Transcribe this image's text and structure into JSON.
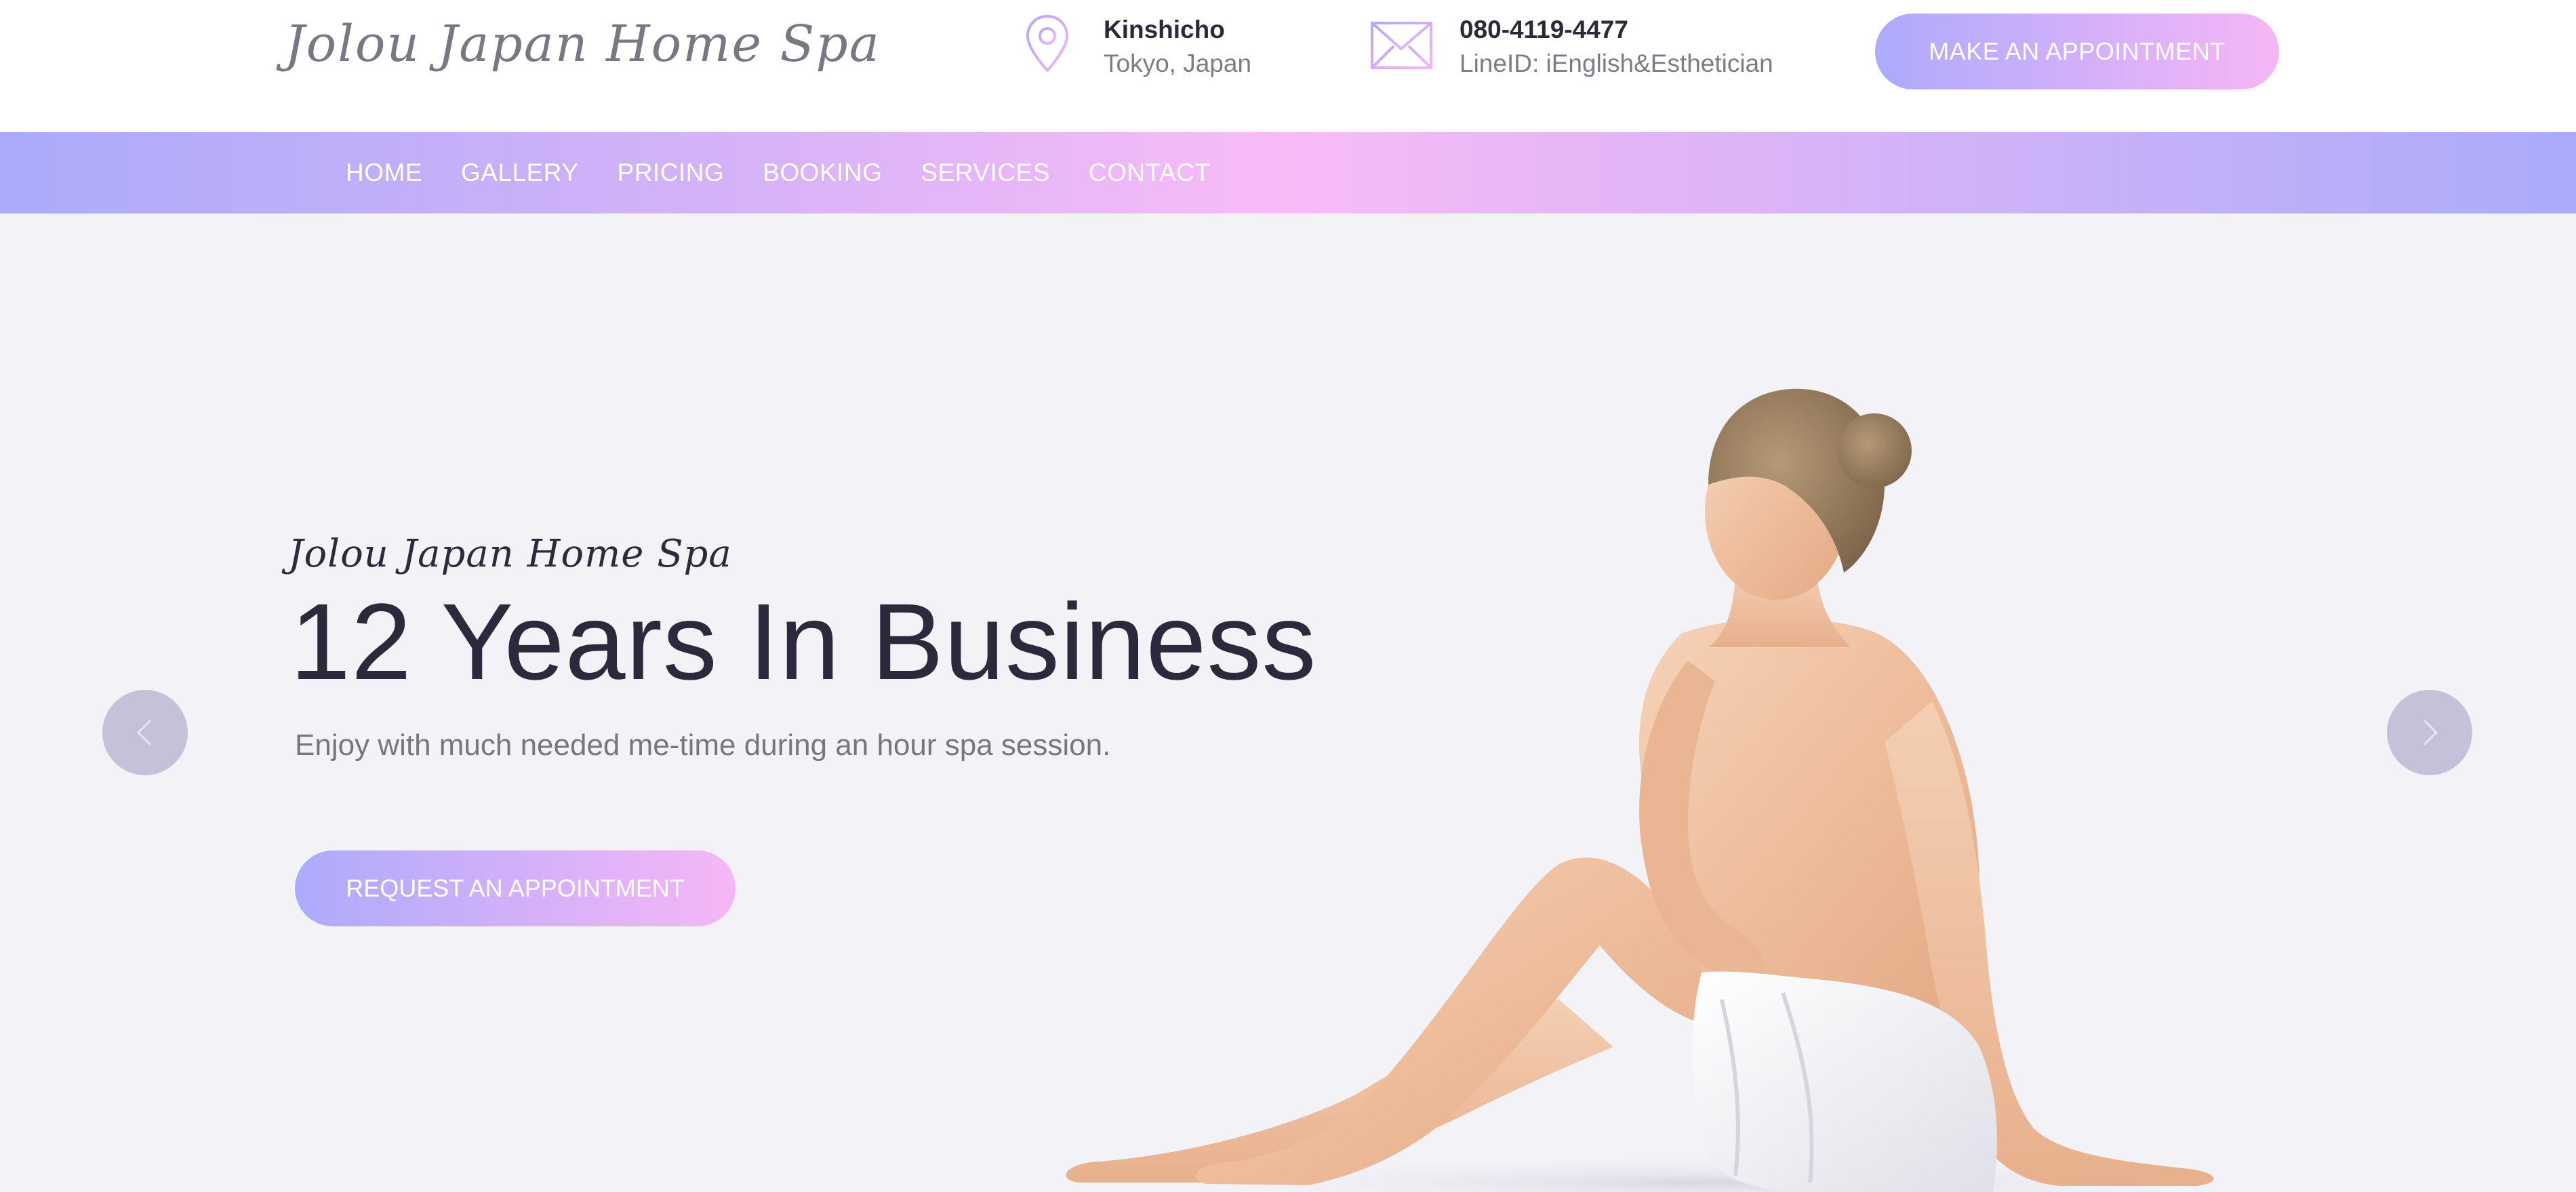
{
  "header": {
    "logo_text": "Jolou Japan Home Spa",
    "location": {
      "icon": "map-pin-icon",
      "title": "Kinshicho",
      "subtitle": "Tokyo, Japan"
    },
    "contact": {
      "icon": "envelope-icon",
      "title": "080-4119-4477",
      "subtitle": "LineID: iEnglish&Esthetician"
    },
    "appointment_button": "MAKE AN APPOINTMENT"
  },
  "nav": {
    "items": [
      {
        "label": "HOME"
      },
      {
        "label": "GALLERY"
      },
      {
        "label": "PRICING"
      },
      {
        "label": "BOOKING"
      },
      {
        "label": "SERVICES"
      },
      {
        "label": "CONTACT"
      }
    ]
  },
  "hero": {
    "script_title": "Jolou Japan Home Spa",
    "title": "12 Years In Business",
    "subtitle": "Enjoy with much needed me-time during an hour spa session.",
    "button": "REQUEST AN APPOINTMENT",
    "prev_icon": "chevron-left-icon",
    "next_icon": "chevron-right-icon",
    "image": "woman-with-towel-photo"
  },
  "colors": {
    "gradient_start": "#adaafc",
    "gradient_end": "#f6b6f6",
    "hero_bg": "#f3f2f7",
    "heading": "#2b2a3c",
    "text_muted": "#77757f"
  }
}
